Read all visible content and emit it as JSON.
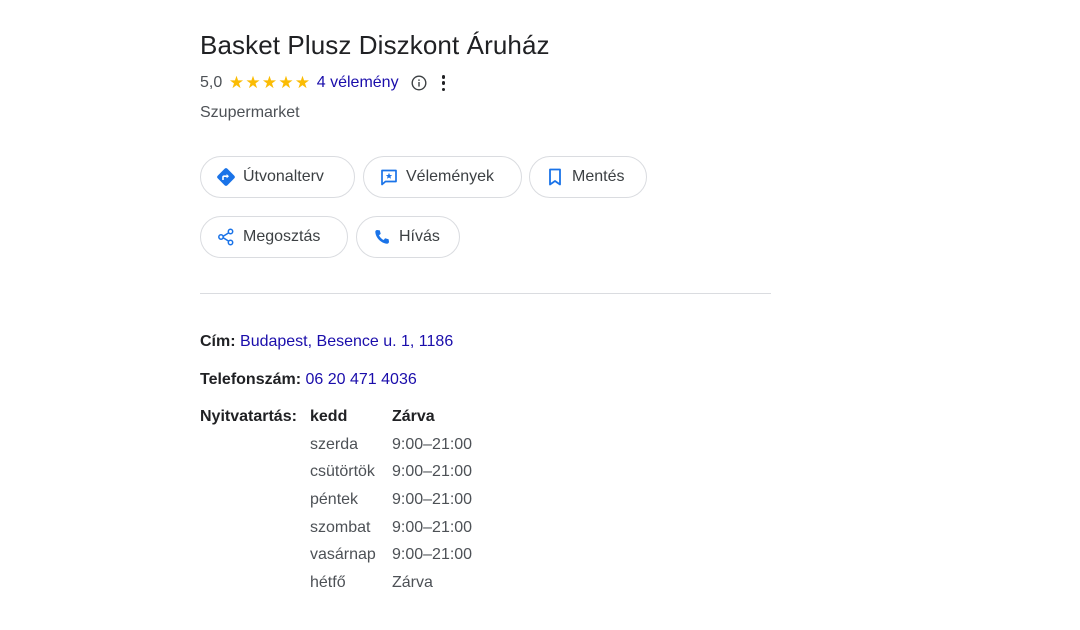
{
  "business": {
    "name": "Basket Plusz Diszkont Áruház",
    "rating": "5,0",
    "stars_filled": 5,
    "stars_total": 5,
    "reviews_label": "4 vélemény",
    "category": "Szupermarket"
  },
  "actions": {
    "route": "Útvonalterv",
    "reviews": "Vélemények",
    "save": "Mentés",
    "share": "Megosztás",
    "call": "Hívás"
  },
  "details": {
    "address_label": "Cím:",
    "address_value": "Budapest, Besence u. 1, 1186",
    "phone_label": "Telefonszám:",
    "phone_value": "06 20 471 4036",
    "hours_label": "Nyitvatartás:",
    "hours": [
      {
        "day": "kedd",
        "time": "Zárva",
        "today": true
      },
      {
        "day": "szerda",
        "time": "9:00–21:00"
      },
      {
        "day": "csütörtök",
        "time": "9:00–21:00"
      },
      {
        "day": "péntek",
        "time": "9:00–21:00"
      },
      {
        "day": "szombat",
        "time": "9:00–21:00"
      },
      {
        "day": "vasárnap",
        "time": "9:00–21:00"
      },
      {
        "day": "hétfő",
        "time": "Zárva"
      }
    ]
  },
  "colors": {
    "star": "#fbbc04",
    "link": "#1a0dab",
    "icon_blue": "#1a73e8",
    "border": "#dadce0"
  },
  "icons": {
    "route": "directions-diamond-icon",
    "reviews": "rate-review-icon",
    "save": "bookmark-icon",
    "share": "share-icon",
    "call": "phone-icon",
    "info": "info-circle-icon",
    "more": "more-vertical-icon"
  }
}
